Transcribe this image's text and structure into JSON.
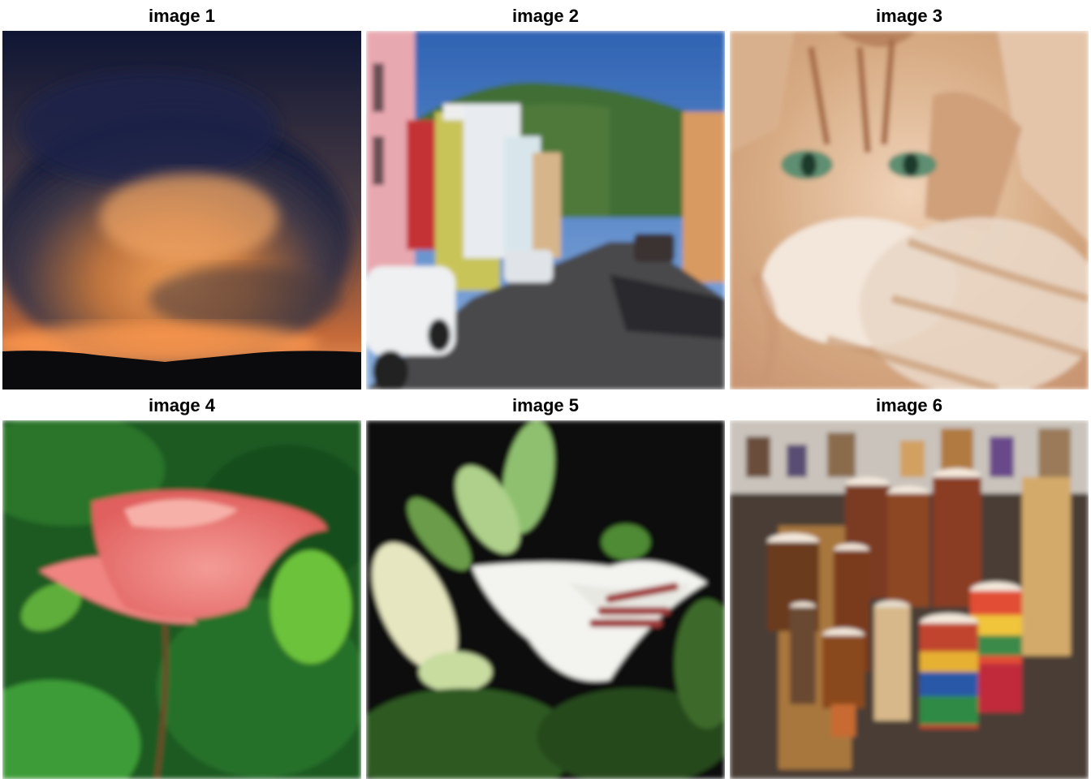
{
  "panels": [
    {
      "title": "image 1",
      "subject": "stormy sunset sky"
    },
    {
      "title": "image 2",
      "subject": "street with colorful houses and hill"
    },
    {
      "title": "image 3",
      "subject": "orange tabby cat"
    },
    {
      "title": "image 4",
      "subject": "pink rose"
    },
    {
      "title": "image 5",
      "subject": "white lily"
    },
    {
      "title": "image 6",
      "subject": "djembe drums"
    }
  ]
}
